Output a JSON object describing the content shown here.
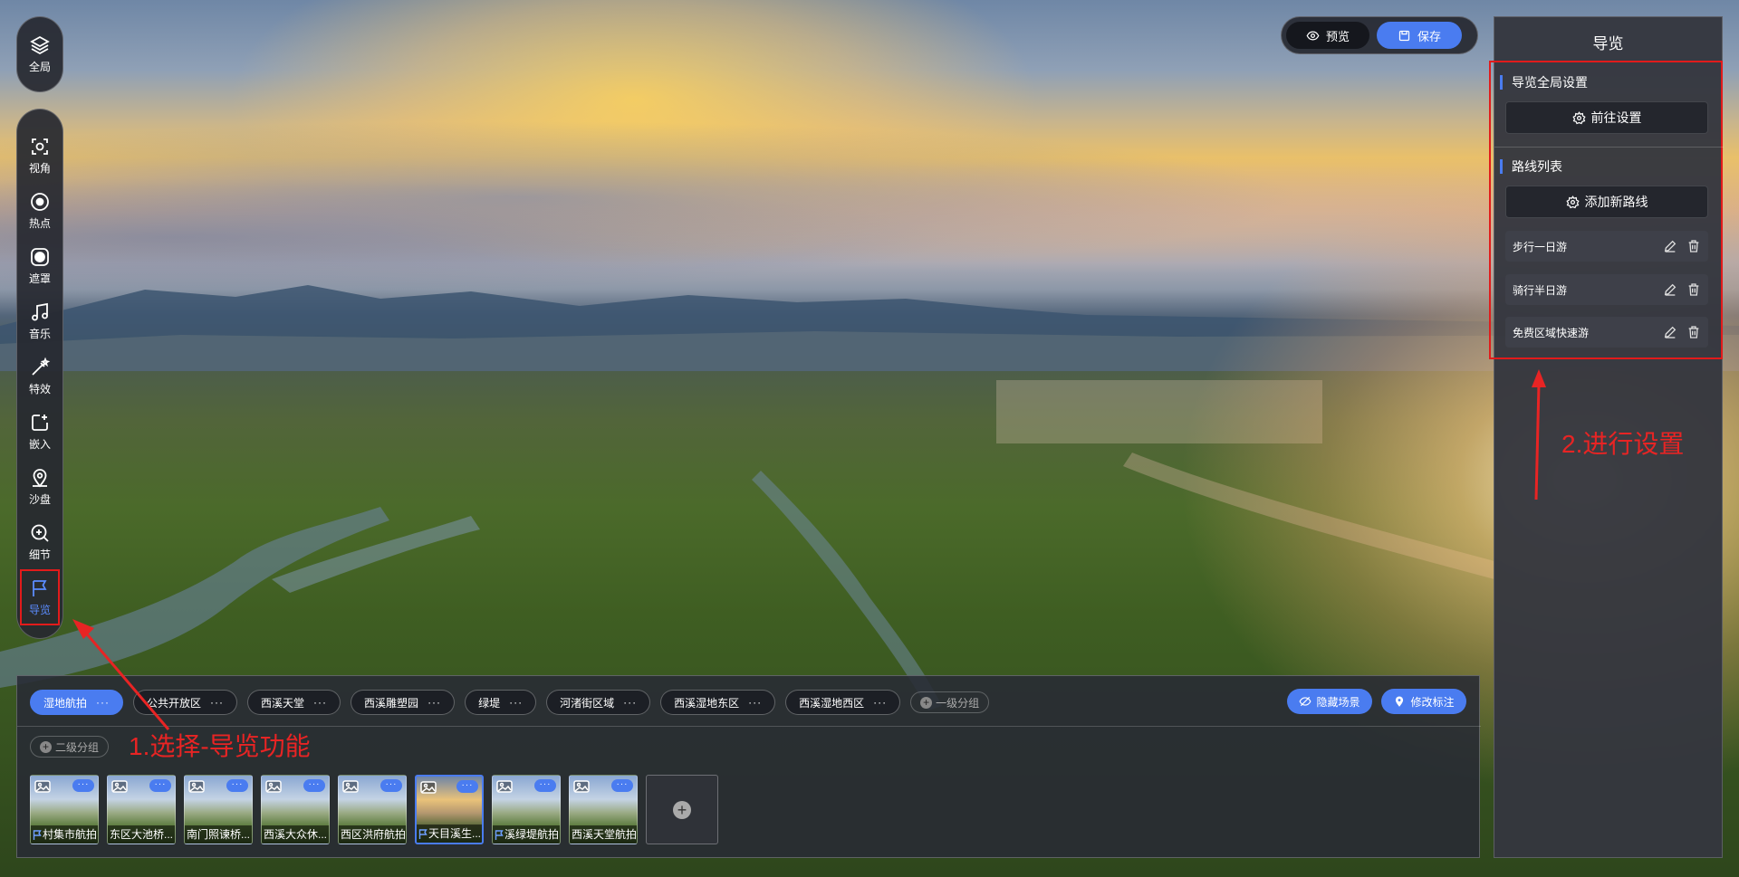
{
  "toolbar": {
    "global": {
      "label": "全局",
      "icon": "layers-icon"
    },
    "items": [
      {
        "key": "view",
        "label": "视角",
        "icon": "viewpoint-icon"
      },
      {
        "key": "hotspot",
        "label": "热点",
        "icon": "target-icon"
      },
      {
        "key": "mask",
        "label": "遮罩",
        "icon": "mask-icon"
      },
      {
        "key": "music",
        "label": "音乐",
        "icon": "music-icon"
      },
      {
        "key": "effects",
        "label": "特效",
        "icon": "magic-wand-icon"
      },
      {
        "key": "embed",
        "label": "嵌入",
        "icon": "embed-icon"
      },
      {
        "key": "sandbox",
        "label": "沙盘",
        "icon": "map-pin-icon"
      },
      {
        "key": "detail",
        "label": "细节",
        "icon": "zoom-in-icon"
      },
      {
        "key": "tour",
        "label": "导览",
        "icon": "flag-icon",
        "active": true
      }
    ]
  },
  "top_buttons": {
    "preview": "预览",
    "save": "保存"
  },
  "right_panel": {
    "title": "导览",
    "global_section": "导览全局设置",
    "goto_settings": "前往设置",
    "route_section": "路线列表",
    "add_route": "添加新路线",
    "routes": [
      "步行一日游",
      "骑行半日游",
      "免费区域快速游"
    ]
  },
  "annotations": {
    "step1": "1.选择-导览功能",
    "step2": "2.进行设置",
    "color": "#e21b1b"
  },
  "bottom": {
    "groups": [
      "湿地航拍",
      "公共开放区",
      "西溪天堂",
      "西溪雕塑园",
      "绿堤",
      "河渚街区域",
      "西溪湿地东区",
      "西溪湿地西区"
    ],
    "active_group": 0,
    "more_label": "···",
    "add_group": "一级分组",
    "add_subgroup": "二级分组",
    "hide_scene": "隐藏场景",
    "edit_marker": "修改标注",
    "scenes": [
      {
        "name": "村集市航拍",
        "flag": true
      },
      {
        "name": "东区大池桥...",
        "flag": false
      },
      {
        "name": "南门照谏桥...",
        "flag": false
      },
      {
        "name": "西溪大众休...",
        "flag": false
      },
      {
        "name": "西区洪府航拍",
        "flag": false
      },
      {
        "name": "天目溪生...",
        "flag": true,
        "selected": true
      },
      {
        "name": "溪绿堤航拍",
        "flag": true
      },
      {
        "name": "西溪天堂航拍",
        "flag": false
      }
    ]
  },
  "colors": {
    "accent": "#4a7cf0",
    "panel": "#34363e",
    "annotation": "#e21b1b"
  }
}
